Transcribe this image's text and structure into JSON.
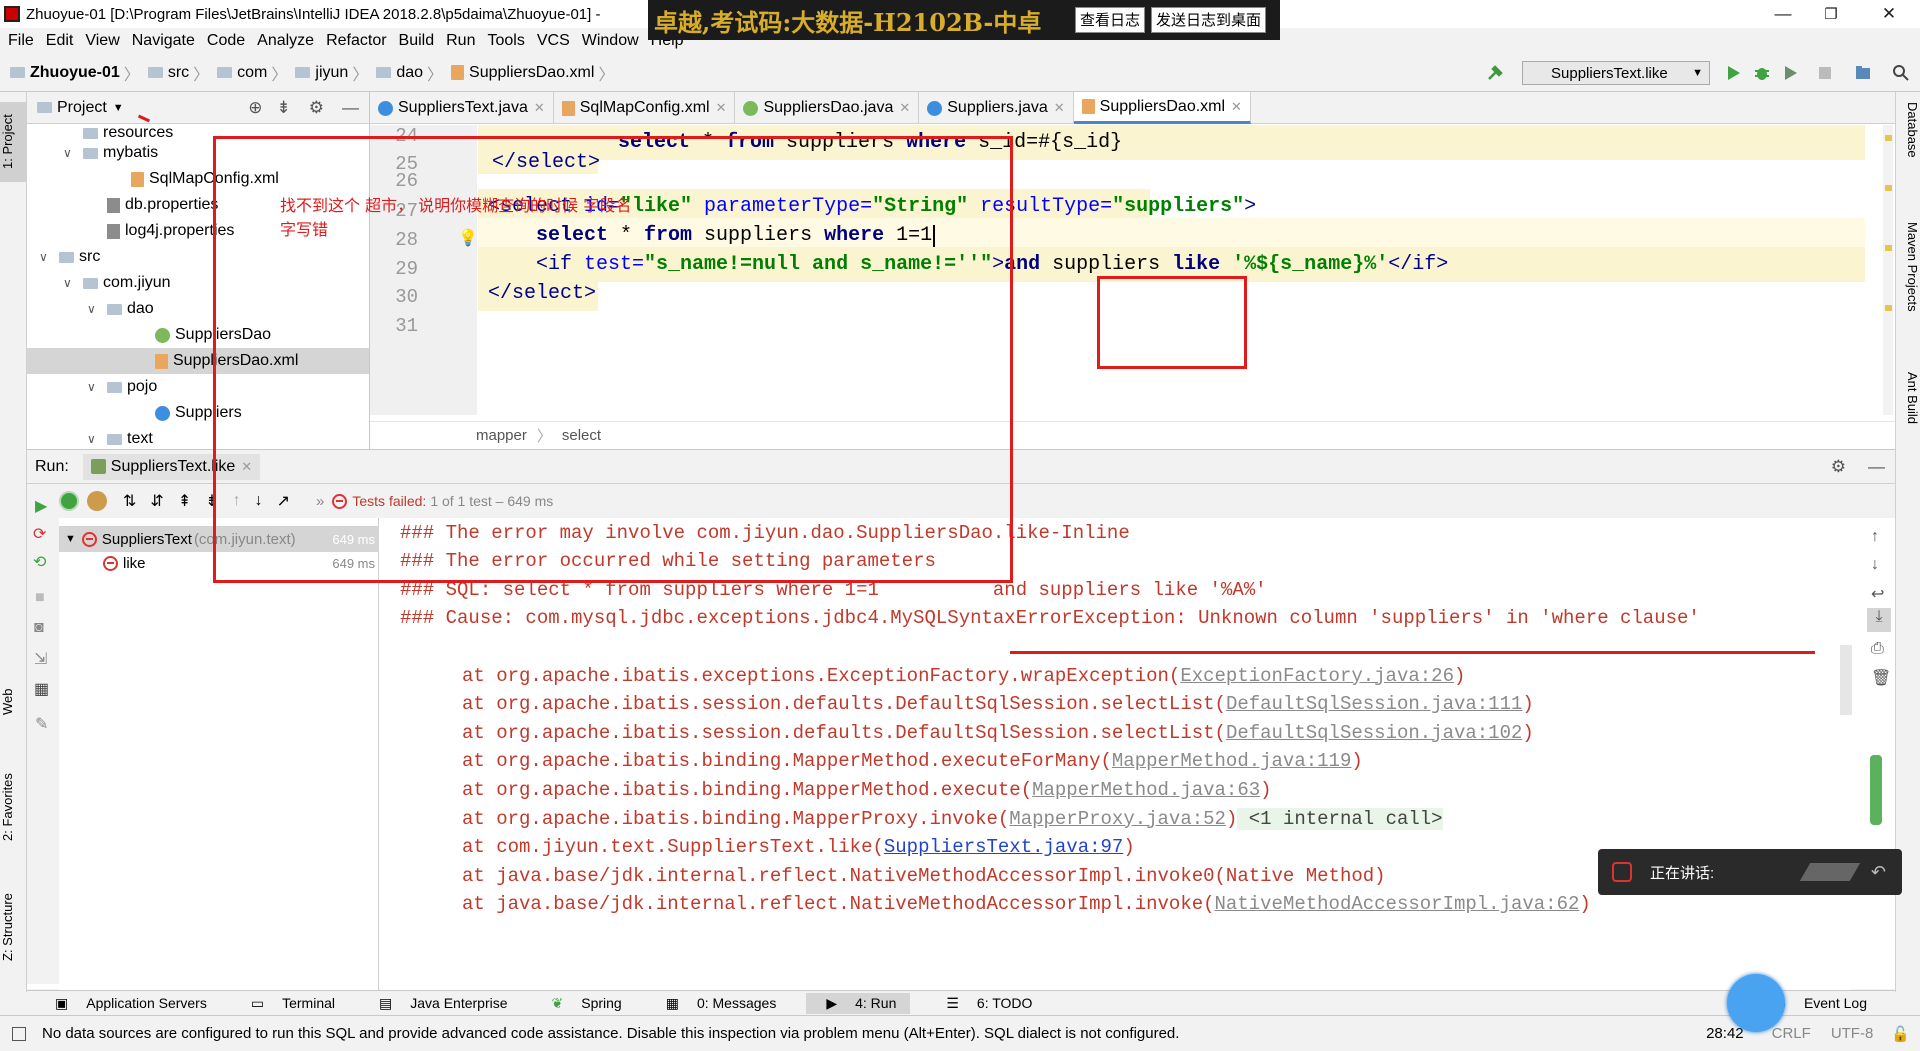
{
  "window": {
    "title": "Zhuoyue-01 [D:\\Program Files\\JetBrains\\IntelliJ IDEA 2018.2.8\\p5daima\\Zhuoyue-01] -",
    "minimize": "—",
    "restore": "❐",
    "close": "✕"
  },
  "overlay": {
    "banner_text": "卓越,考试码:大数据-H2102B-中卓",
    "view_log_button": "查看日志",
    "send_log_button": "发送日志到桌面"
  },
  "menu": [
    "File",
    "Edit",
    "View",
    "Navigate",
    "Code",
    "Analyze",
    "Refactor",
    "Build",
    "Run",
    "Tools",
    "VCS",
    "Window",
    "Help"
  ],
  "breadcrumb": [
    "Zhuoyue-01",
    "src",
    "com",
    "jiyun",
    "dao",
    "SuppliersDao.xml"
  ],
  "run_config": "SuppliersText.like",
  "project_panel": {
    "title": "Project",
    "items": [
      {
        "label": "resources",
        "indent": 2,
        "type": "folder"
      },
      {
        "label": "mybatis",
        "indent": 2,
        "type": "folder",
        "arrow": "down"
      },
      {
        "label": "SqlMapConfig.xml",
        "indent": 4,
        "type": "xml"
      },
      {
        "label": "db.properties",
        "indent": 3,
        "type": "prop"
      },
      {
        "label": "log4j.properties",
        "indent": 3,
        "type": "prop"
      },
      {
        "label": "src",
        "indent": 1,
        "type": "folder",
        "arrow": "down"
      },
      {
        "label": "com.jiyun",
        "indent": 2,
        "type": "folder",
        "arrow": "down"
      },
      {
        "label": "dao",
        "indent": 3,
        "type": "folder",
        "arrow": "down"
      },
      {
        "label": "SuppliersDao",
        "indent": 5,
        "type": "interface"
      },
      {
        "label": "SuppliersDao.xml",
        "indent": 5,
        "type": "xml",
        "selected": true
      },
      {
        "label": "pojo",
        "indent": 3,
        "type": "folder",
        "arrow": "down"
      },
      {
        "label": "Suppliers",
        "indent": 5,
        "type": "class"
      },
      {
        "label": "text",
        "indent": 3,
        "type": "folder",
        "arrow": "down"
      }
    ]
  },
  "editor": {
    "tabs": [
      {
        "label": "SuppliersText.java",
        "active": false
      },
      {
        "label": "SqlMapConfig.xml",
        "active": false
      },
      {
        "label": "SuppliersDao.java",
        "active": false
      },
      {
        "label": "Suppliers.java",
        "active": false
      },
      {
        "label": "SuppliersDao.xml",
        "active": true
      }
    ],
    "line_numbers": [
      "24",
      "25",
      "26",
      "27",
      "28",
      "29",
      "30",
      "31"
    ],
    "lines": {
      "l24_a": "select",
      "l24_b": " * ",
      "l24_c": "from",
      "l24_d": " suppliers ",
      "l24_e": "where",
      "l24_f": " s_id=#{s_id}",
      "l25_a": "</",
      "l25_b": "select",
      "l25_c": ">",
      "l27_a": "<select ",
      "l27_b": "id=",
      "l27_c": "\"like\"",
      "l27_d": " parameterType=",
      "l27_e": "\"String\"",
      "l27_f": " resultType=",
      "l27_g": "\"suppliers\"",
      "l27_h": ">",
      "l28_a": "select",
      "l28_b": " * ",
      "l28_c": "from",
      "l28_d": " suppliers ",
      "l28_e": "where",
      "l28_f": " 1=1",
      "l29_a": "<if ",
      "l29_b": "test=",
      "l29_c": "\"s_name!=null and s_name!=''\"",
      "l29_d": ">",
      "l29_e": "and",
      "l29_f": " suppliers ",
      "l29_g": "like",
      "l29_h": " '%${s_name}%'",
      "l29_i": "</if>",
      "l30_a": "</",
      "l30_b": "select",
      "l30_c": ">"
    },
    "breadcrumb": [
      "mapper",
      "select"
    ]
  },
  "annotation": {
    "line1": "找不到这个  超市， 说明你模糊查询的时候  字段名",
    "line2": "字写错"
  },
  "run_panel": {
    "label": "Run:",
    "config_tab": "SuppliersText.like",
    "status": "Tests failed:",
    "status_detail": "1 of 1 test – 649 ms",
    "tests": [
      {
        "name": "SuppliersText",
        "pkg": "(com.jiyun.text)",
        "time": "649 ms"
      },
      {
        "name": "like",
        "pkg": "",
        "time": "649 ms"
      }
    ],
    "console": [
      {
        "text": "### The error may involve com.jiyun.dao.SuppliersDao.like-Inline"
      },
      {
        "text": "### The error occurred while setting parameters"
      },
      {
        "text": "### SQL: select * from suppliers where 1=1          and suppliers like '%A%'"
      },
      {
        "text": "### Cause: com.mysql.jdbc.exceptions.jdbc4.MySQLSyntaxErrorException: Unknown column 'suppliers' in 'where clause'"
      },
      {
        "text": ""
      },
      {
        "prefix": "at org.apache.ibatis.exceptions.ExceptionFactory.wrapException(",
        "link": "ExceptionFactory.java:26",
        "suffix": ")"
      },
      {
        "prefix": "at org.apache.ibatis.session.defaults.DefaultSqlSession.selectList(",
        "link": "DefaultSqlSession.java:111",
        "suffix": ")"
      },
      {
        "prefix": "at org.apache.ibatis.session.defaults.DefaultSqlSession.selectList(",
        "link": "DefaultSqlSession.java:102",
        "suffix": ")"
      },
      {
        "prefix": "at org.apache.ibatis.binding.MapperMethod.executeForMany(",
        "link": "MapperMethod.java:119",
        "suffix": ")"
      },
      {
        "prefix": "at org.apache.ibatis.binding.MapperMethod.execute(",
        "link": "MapperMethod.java:63",
        "suffix": ")"
      },
      {
        "prefix": "at org.apache.ibatis.binding.MapperProxy.invoke(",
        "link": "MapperProxy.java:52",
        "suffix": ")",
        "extra": " <1 internal call>"
      },
      {
        "prefix": "at com.jiyun.text.SuppliersText.like(",
        "link": "SuppliersText.java:97",
        "suffix": ")",
        "blue": true
      },
      {
        "prefix": "at java.base/jdk.internal.reflect.NativeMethodAccessorImpl.invoke0(Native Method)",
        "link": "",
        "suffix": ""
      },
      {
        "prefix": "at java.base/jdk.internal.reflect.NativeMethodAccessorImpl.invoke(",
        "link": "NativeMethodAccessorImpl.java:62",
        "suffix": ")"
      }
    ]
  },
  "speaking_popup": "正在讲话:",
  "bottom_tabs": [
    "Application Servers",
    "Terminal",
    "Java Enterprise",
    "Spring",
    "0: Messages",
    "4: Run",
    "6: TODO"
  ],
  "event_log": "Event Log",
  "left_tool_tabs": [
    "1: Project",
    "Web",
    "2: Favorites",
    "Z: Structure"
  ],
  "right_tool_tabs": [
    "Database",
    "Maven Projects",
    "Ant Build"
  ],
  "status": {
    "message": "No data sources are configured to run this SQL and provide advanced code assistance. Disable this inspection via problem menu (Alt+Enter). SQL dialect is not configured.",
    "position": "28:42",
    "line_sep": "CRLF",
    "encoding": "UTF-8"
  },
  "colors": {
    "error": "#c0392b",
    "annotation": "#e01b1b",
    "accent": "#4a86c7",
    "highlight": "#fbf4d0"
  }
}
